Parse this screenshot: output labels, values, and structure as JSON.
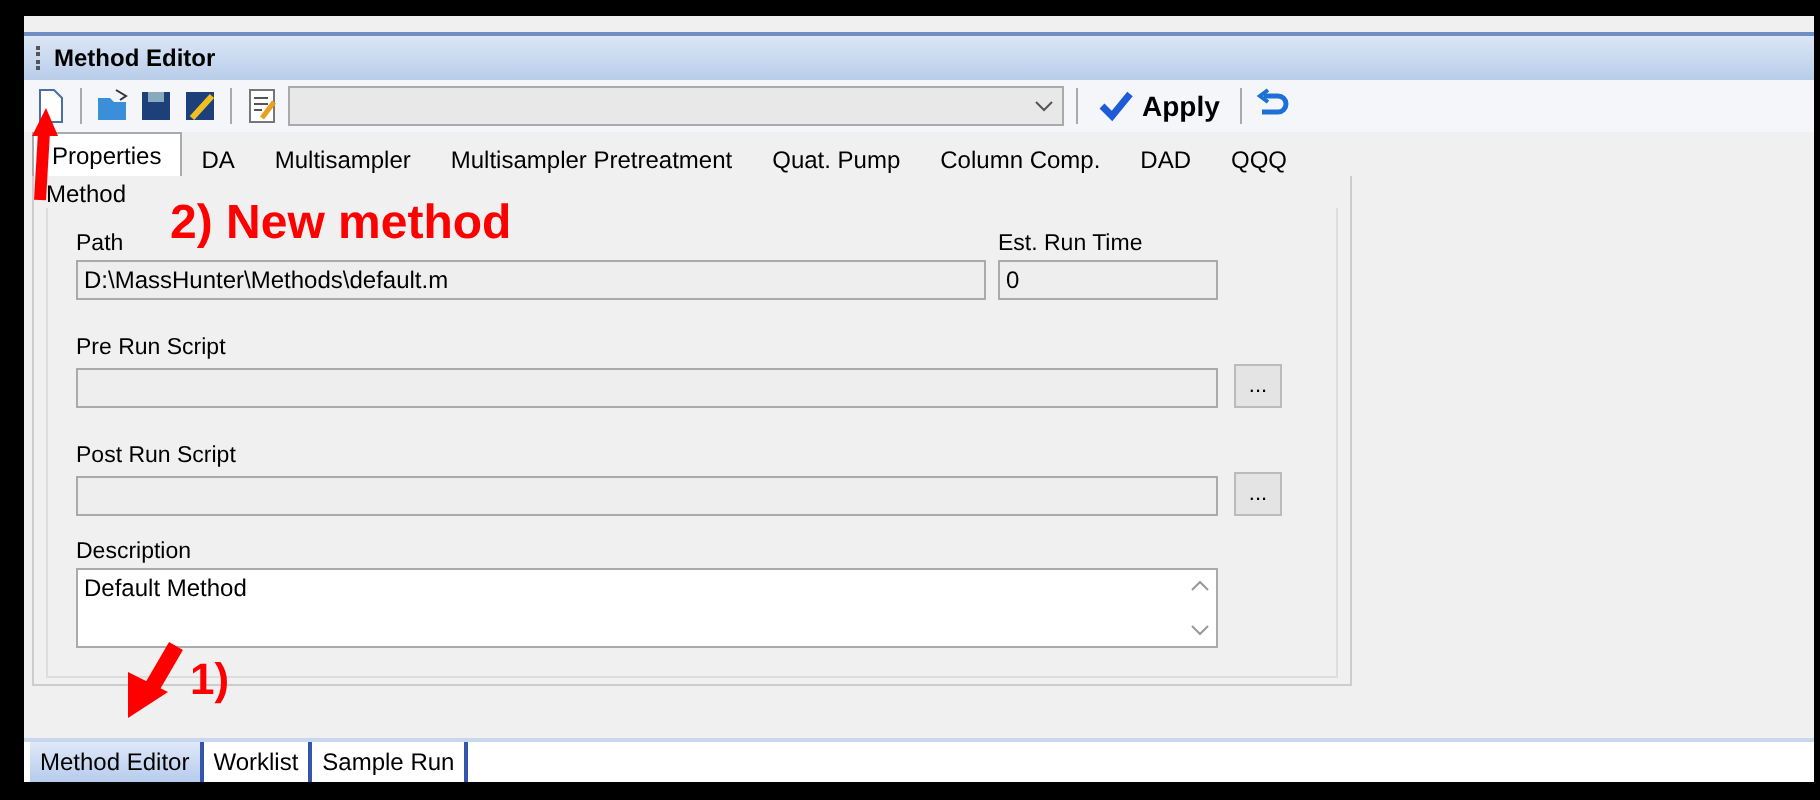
{
  "window": {
    "title": "Method Editor"
  },
  "toolbar": {
    "apply": "Apply"
  },
  "tabs": [
    {
      "label": "Properties",
      "selected": true
    },
    {
      "label": "DA",
      "selected": false
    },
    {
      "label": "Multisampler",
      "selected": false
    },
    {
      "label": "Multisampler Pretreatment",
      "selected": false
    },
    {
      "label": "Quat. Pump",
      "selected": false
    },
    {
      "label": "Column Comp.",
      "selected": false
    },
    {
      "label": "DAD",
      "selected": false
    },
    {
      "label": "QQQ",
      "selected": false
    }
  ],
  "group": {
    "title": "Method"
  },
  "path": {
    "label": "Path",
    "value": "D:\\MassHunter\\Methods\\default.m"
  },
  "est_run_time": {
    "label": "Est. Run Time",
    "value": "0"
  },
  "pre_run_script": {
    "label": "Pre Run Script",
    "button": "..."
  },
  "post_run_script": {
    "label": "Post Run Script",
    "button": "..."
  },
  "description": {
    "label": "Description",
    "value": "Default Method"
  },
  "bottom_tabs": [
    {
      "label": "Method Editor",
      "selected": true
    },
    {
      "label": "Worklist",
      "selected": false
    },
    {
      "label": "Sample Run",
      "selected": false
    }
  ],
  "annotations": [
    {
      "label": "2) New method"
    },
    {
      "label": "1)"
    }
  ]
}
